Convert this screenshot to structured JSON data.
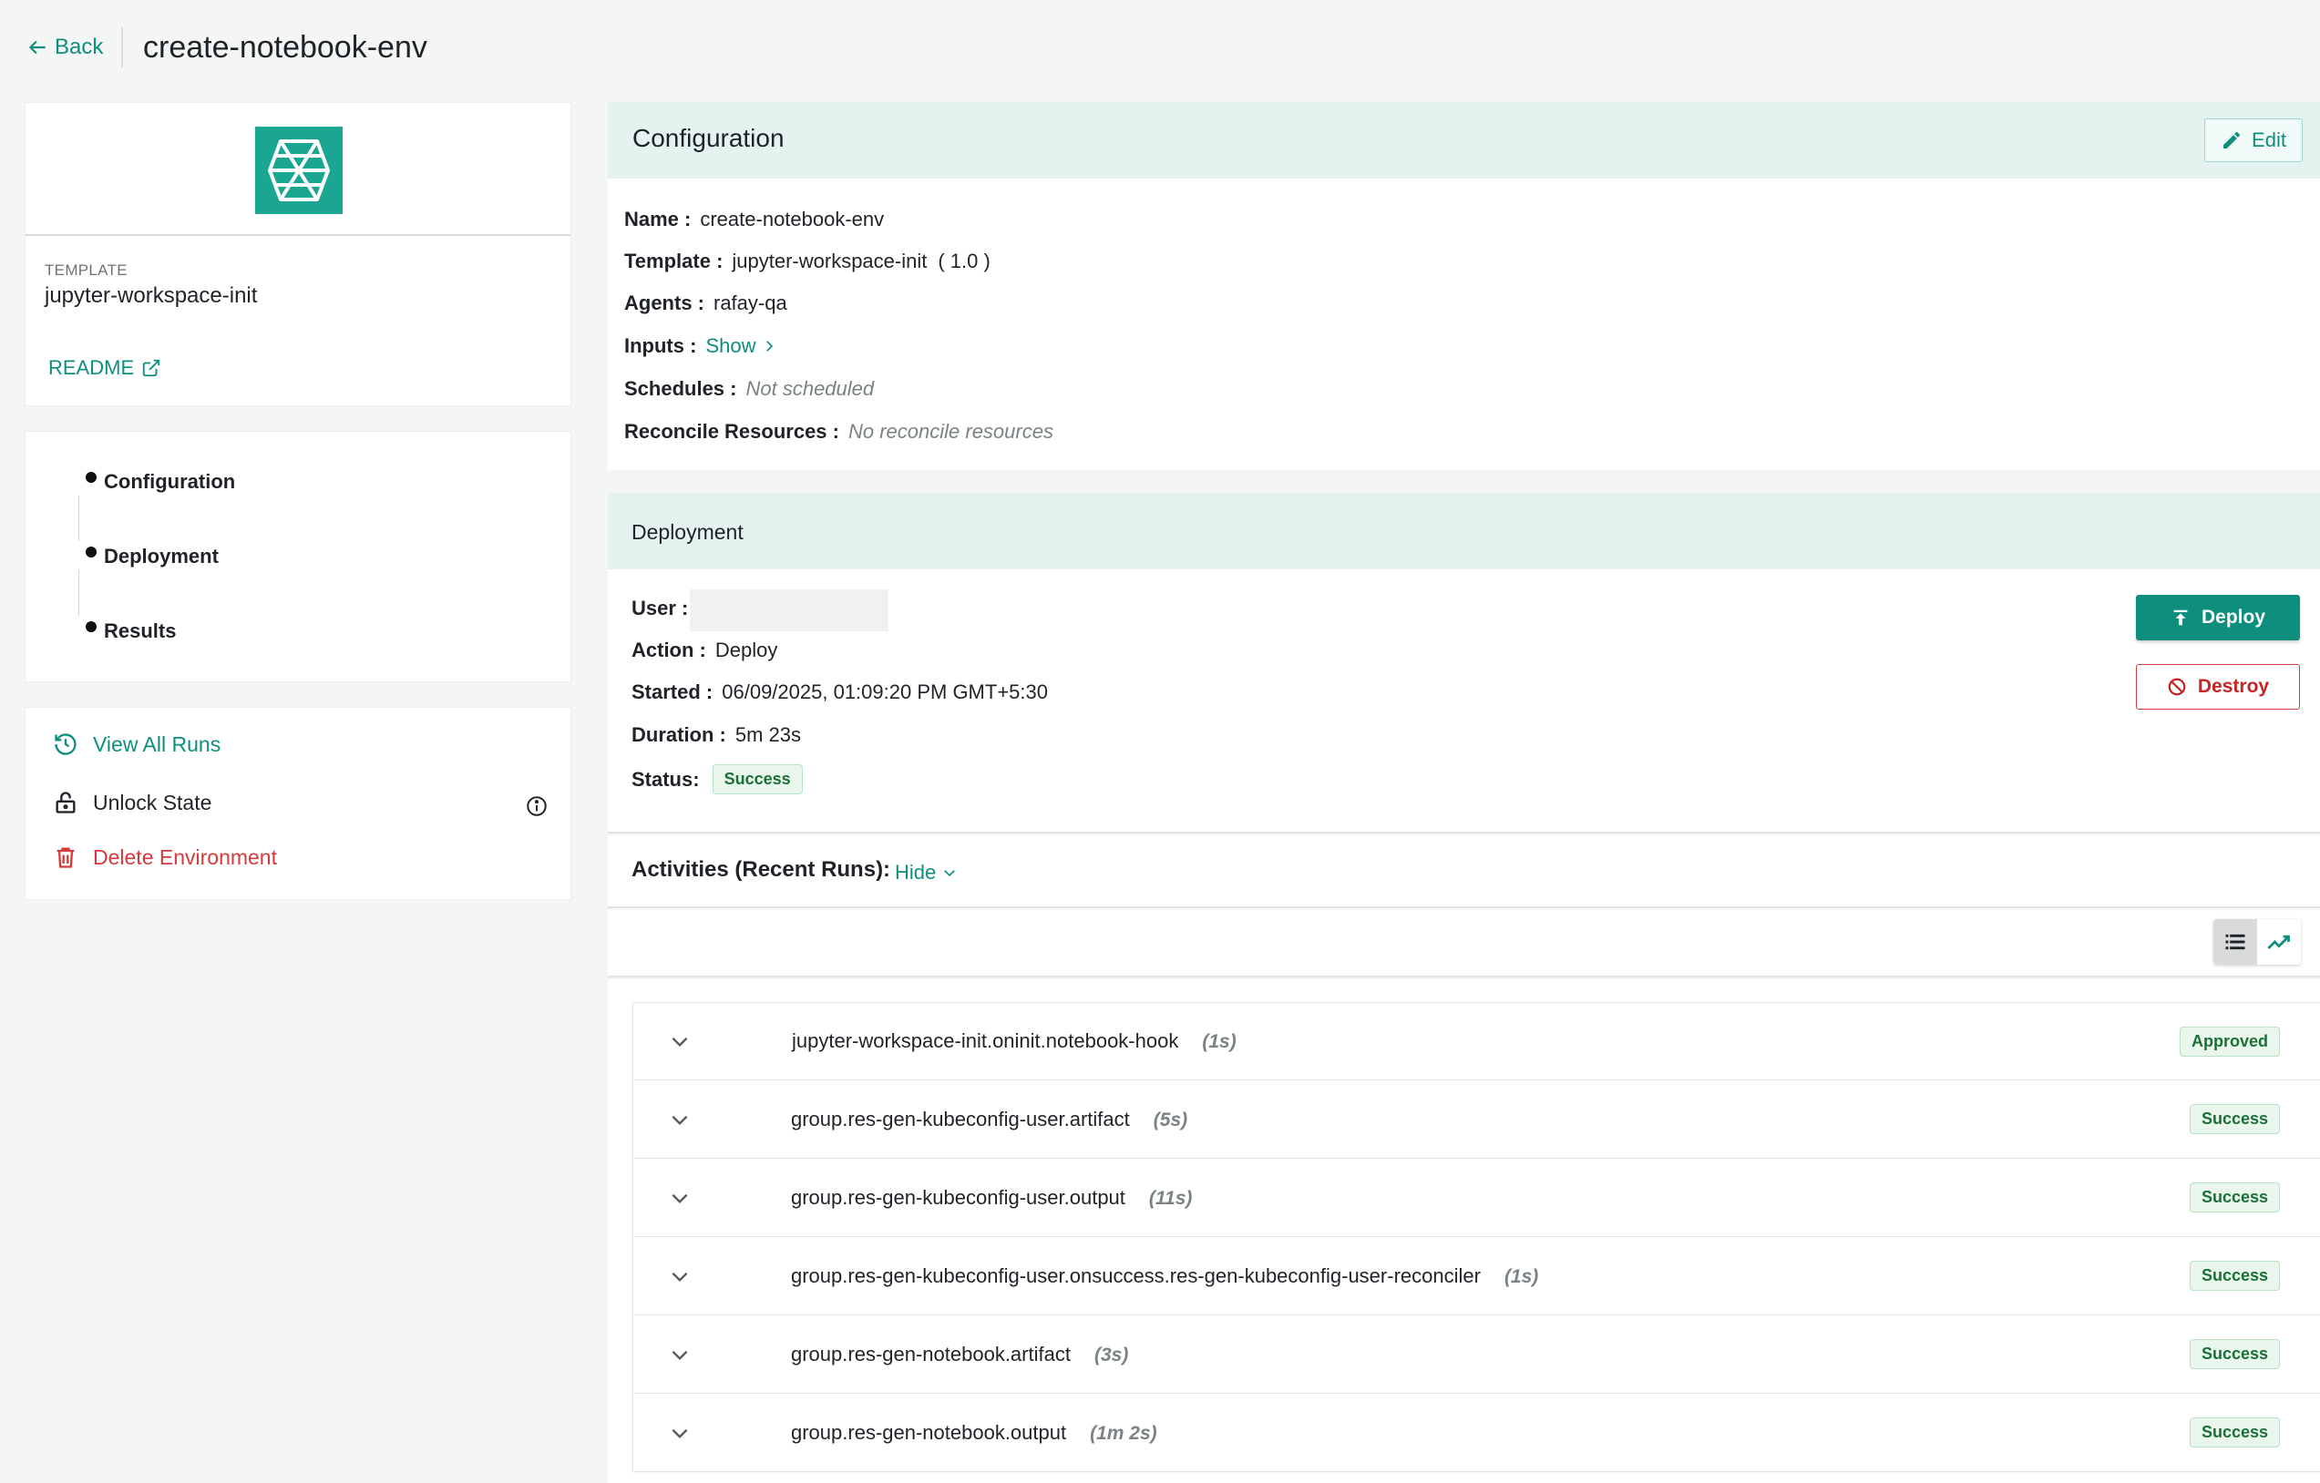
{
  "header": {
    "back_label": "Back",
    "title": "create-notebook-env"
  },
  "template_card": {
    "logo_icon": "rafay-template-logo",
    "label": "TEMPLATE",
    "value": "jupyter-workspace-init",
    "readme_label": "README"
  },
  "steps": [
    {
      "label": "Configuration"
    },
    {
      "label": "Deployment"
    },
    {
      "label": "Results"
    }
  ],
  "actions": {
    "view_all_runs": "View All Runs",
    "unlock_state": "Unlock State",
    "delete_environment": "Delete Environment"
  },
  "configuration": {
    "title": "Configuration",
    "edit_label": "Edit",
    "name_key": "Name :",
    "name_value": "create-notebook-env",
    "template_key": "Template :",
    "template_value": "jupyter-workspace-init",
    "template_version": "( 1.0 )",
    "agents_key": "Agents :",
    "agents_value": "rafay-qa",
    "inputs_key": "Inputs :",
    "inputs_link": "Show",
    "schedules_key": "Schedules :",
    "schedules_value": "Not scheduled",
    "reconcile_key": "Reconcile Resources :",
    "reconcile_value": "No reconcile resources"
  },
  "deployment": {
    "title": "Deployment",
    "user_key": "User :",
    "action_key": "Action :",
    "action_value": "Deploy",
    "started_key": "Started :",
    "started_value": "06/09/2025, 01:09:20 PM GMT+5:30",
    "duration_key": "Duration :",
    "duration_value": "5m 23s",
    "status_key": "Status:",
    "status_value": "Success",
    "deploy_label": "Deploy",
    "destroy_label": "Destroy"
  },
  "activities": {
    "title": "Activities (Recent Runs):",
    "hide_label": "Hide",
    "runs": [
      {
        "name": "jupyter-workspace-init.oninit.notebook-hook",
        "duration": "(1s)",
        "status": "Approved"
      },
      {
        "name": "group.res-gen-kubeconfig-user.artifact",
        "duration": "(5s)",
        "status": "Success"
      },
      {
        "name": "group.res-gen-kubeconfig-user.output",
        "duration": "(11s)",
        "status": "Success"
      },
      {
        "name": "group.res-gen-kubeconfig-user.onsuccess.res-gen-kubeconfig-user-reconciler",
        "duration": "(1s)",
        "status": "Success"
      },
      {
        "name": "group.res-gen-notebook.artifact",
        "duration": "(3s)",
        "status": "Success"
      },
      {
        "name": "group.res-gen-notebook.output",
        "duration": "(1m 2s)",
        "status": "Success"
      }
    ]
  },
  "colors": {
    "accent": "#0e8f7e",
    "panel_header": "#e5f3f0",
    "danger": "#c52424",
    "success_bg": "#e8f6ec",
    "success_text": "#1b6f37"
  }
}
